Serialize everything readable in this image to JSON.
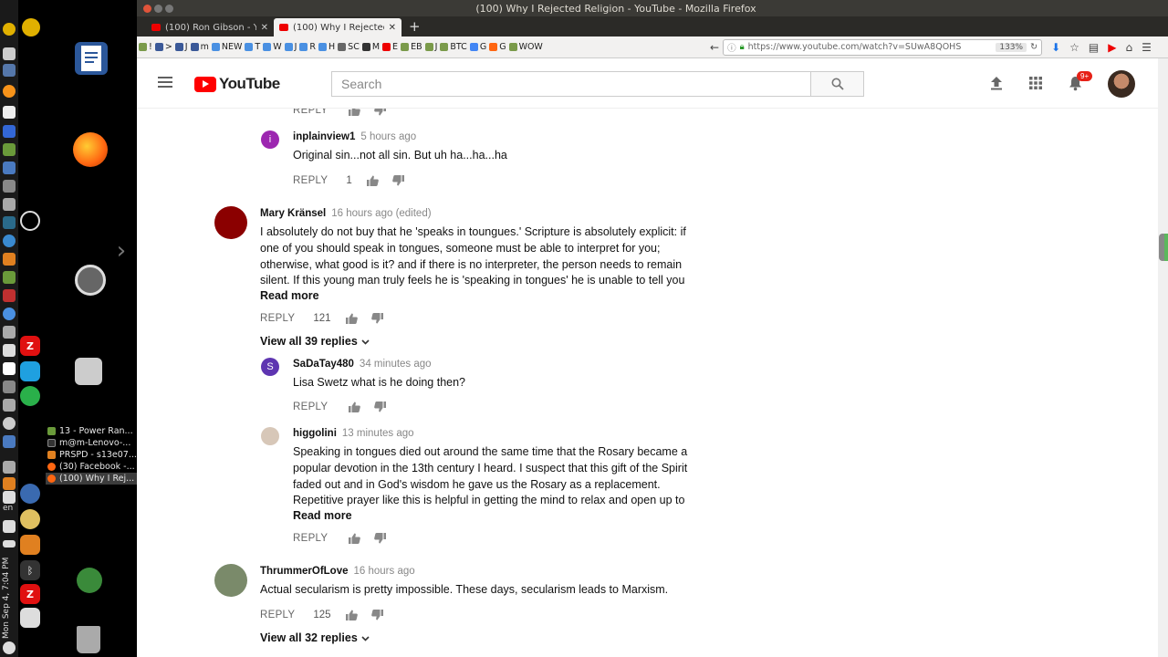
{
  "system_panel": {
    "clock": "Mon Sep 4, 7:04 PM",
    "lang": "en"
  },
  "launcher": {
    "tasks": [
      {
        "label": "13 - Power Ran...",
        "active": false
      },
      {
        "label": "m@m-Lenovo-...",
        "active": false
      },
      {
        "label": "PRSPD - s13e07...",
        "active": false
      },
      {
        "label": "(30) Facebook -...",
        "active": false
      },
      {
        "label": "(100) Why I Rej...",
        "active": true
      }
    ]
  },
  "browser": {
    "window_title": "(100) Why I Rejected Religion - YouTube - Mozilla Firefox",
    "tabs": [
      {
        "label": "(100) Ron Gibson - You",
        "active": false
      },
      {
        "label": "(100) Why I Rejected Re",
        "active": true
      }
    ],
    "new_tab": "+",
    "bookmarks": [
      "!",
      ">",
      "J",
      "m",
      "NEW",
      "T",
      "W",
      "J",
      "R",
      "H",
      "SC",
      "M",
      "E",
      "EB",
      "J",
      "BTC",
      "G",
      "G",
      "WOW"
    ],
    "url": "https://www.youtube.com/watch?v=SUwA8QOHS",
    "zoom": "133%"
  },
  "youtube": {
    "logo_text": "YouTube",
    "search_placeholder": "Search",
    "notification_badge": "9+",
    "comments": [
      {
        "kind": "actions-only",
        "reply": "REPLY",
        "likes": ""
      },
      {
        "kind": "reply",
        "author": "inplainview1",
        "time": "5 hours ago",
        "avatar_letter": "i",
        "avatar_color": "#9c27b0",
        "lines": [
          "Original sin...not all sin. But uh ha...ha...ha"
        ],
        "reply_label": "REPLY",
        "likes": "1"
      },
      {
        "kind": "top",
        "author": "Mary Kränsel",
        "time": "16 hours ago (edited)",
        "avatar_color": "#8b0000",
        "lines": [
          "I absolutely do not buy that he 'speaks in toungues.' Scripture is absolutely explicit: if",
          "one of you should speak in tongues, someone must be able to interpret for you;",
          "otherwise, what good is it? and if there is no interpreter, the person needs to remain",
          "silent. If this young man truly feels he is 'speaking in tongues' he is unable to tell you"
        ],
        "read_more": "Read more",
        "reply_label": "REPLY",
        "likes": "121",
        "view_all": "View all 39 replies"
      },
      {
        "kind": "reply",
        "author": "SaDaTay480",
        "time": "34 minutes ago",
        "avatar_letter": "S",
        "avatar_color": "#5e35b1",
        "lines": [
          "Lisa Swetz what is he doing then?"
        ],
        "reply_label": "REPLY",
        "likes": ""
      },
      {
        "kind": "reply",
        "author": "higgolini",
        "time": "13 minutes ago",
        "avatar_color": "#d7c7b8",
        "lines": [
          "Speaking in tongues died out around the same time that the Rosary became a",
          "popular devotion in the 13th century I heard.  I suspect that this gift of the Spirit",
          "faded out and in God's wisdom he gave us the Rosary as a replacement.",
          "Repetitive prayer like this is helpful in getting the mind to relax and open up to"
        ],
        "read_more": "Read more",
        "reply_label": "REPLY",
        "likes": ""
      },
      {
        "kind": "top",
        "author": "ThrummerOfLove",
        "time": "16 hours ago",
        "avatar_color": "#7a8a6a",
        "lines": [
          "Actual secularism is pretty impossible. These days, secularism leads to Marxism."
        ],
        "reply_label": "REPLY",
        "likes": "125",
        "view_all": "View all 32 replies"
      }
    ]
  }
}
